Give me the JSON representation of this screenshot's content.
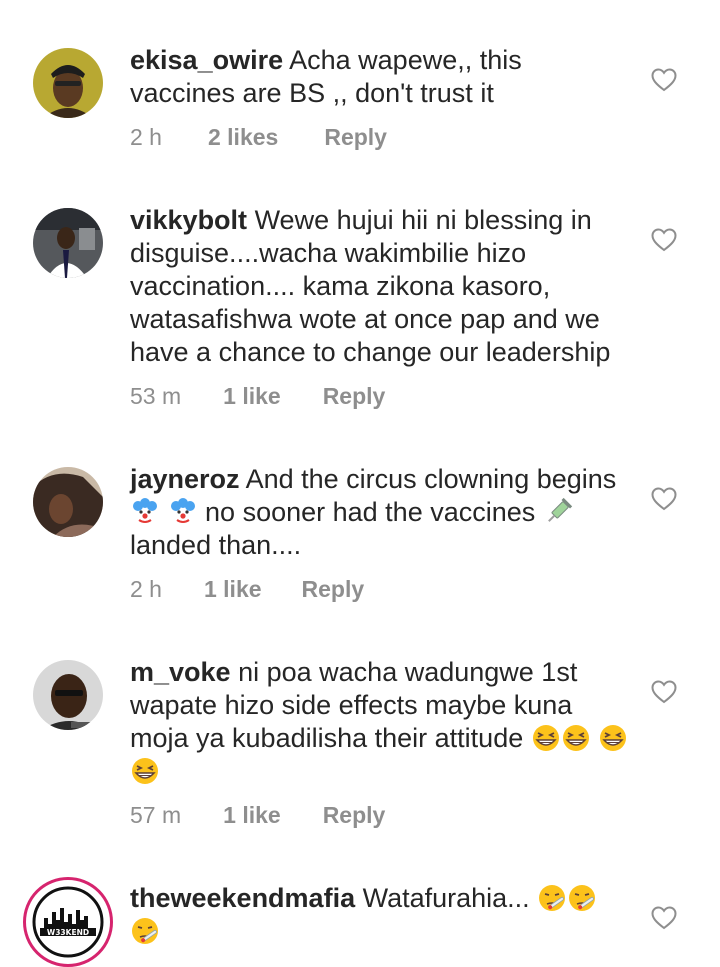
{
  "comments": [
    {
      "username": "ekisa_owire",
      "text": "Acha wapewe,, this vaccines are BS ,, don't trust it",
      "time": "2 h",
      "likes": "2 likes",
      "reply": "Reply"
    },
    {
      "username": "vikkybolt",
      "text": "Wewe hujui hii ni blessing in disguise....wacha wakimbilie hizo vaccination.... kama zikona kasoro, watasafishwa wote at once pap and we have a chance to change our leadership",
      "time": "53 m",
      "likes": "1 like",
      "reply": "Reply"
    },
    {
      "username": "jayneroz",
      "text_1": "And the circus clowning begins",
      "text_2": "no sooner had the vaccines",
      "text_3": "landed than....",
      "emoji_1": "clown-face-emoji",
      "emoji_2": "syringe-emoji",
      "time": "2 h",
      "likes": "1 like",
      "reply": "Reply"
    },
    {
      "username": "m_voke",
      "text": "ni poa wacha wadungwe 1st wapate hizo side effects maybe kuna moja ya kubadilisha their attitude",
      "emoji": "grinning-squinting-face-emoji",
      "time": "57 m",
      "likes": "1 like",
      "reply": "Reply"
    },
    {
      "username": "theweekendmafia",
      "text": "Watafurahia...",
      "emoji": "face-with-thermometer-emoji",
      "avatar_text": "W33KEND"
    }
  ],
  "colors": {
    "text": "#262626",
    "meta": "#8e8e8e",
    "story_ring": "#d6246e"
  }
}
